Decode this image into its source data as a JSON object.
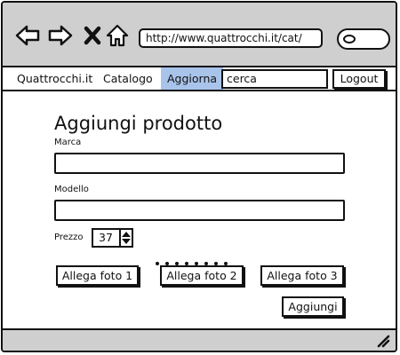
{
  "browser": {
    "url": "http://www.quattrocchi.it/cat/",
    "icons": [
      "back-arrow-icon",
      "forward-arrow-icon",
      "close-x-icon",
      "home-icon",
      "search-icon",
      "resize-grip-icon"
    ]
  },
  "menu": {
    "brand": "Quattrocchi.it",
    "catalog": "Catalogo",
    "update": "Aggiorna",
    "search_value": "cerca",
    "logout": "Logout",
    "active_color": "#a9c4eb"
  },
  "form": {
    "title": "Aggiungi prodotto",
    "brand_label": "Marca",
    "model_label": "Modello",
    "price_label": "Prezzo",
    "price_value": "37",
    "attach_photo_1": "Allega foto 1",
    "attach_photo_2": "Allega foto 2",
    "attach_photo_3": "Allega foto 3",
    "submit": "Aggiungi"
  }
}
